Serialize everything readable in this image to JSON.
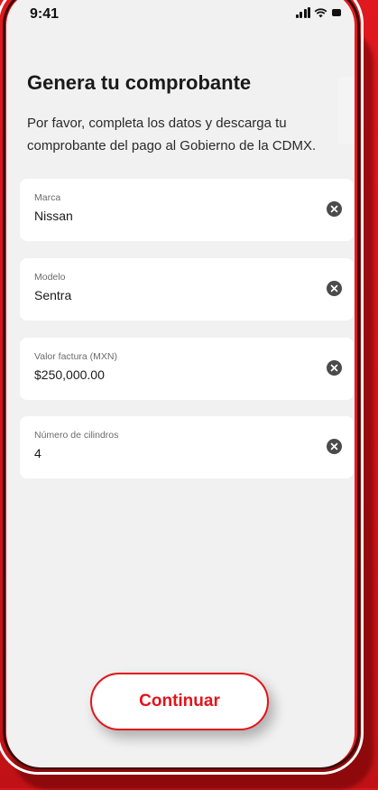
{
  "status_bar": {
    "time": "9:41"
  },
  "header": {
    "title": "Genera tu comprobante",
    "subtitle": "Por favor, completa los datos y descarga tu comprobante del pago al Gobierno de la CDMX."
  },
  "form": {
    "fields": [
      {
        "label": "Marca",
        "value": "Nissan",
        "clear_icon": "clear-icon"
      },
      {
        "label": "Modelo",
        "value": "Sentra",
        "clear_icon": "clear-icon"
      },
      {
        "label": "Valor factura (MXN)",
        "value": "$250,000.00",
        "clear_icon": "clear-icon"
      },
      {
        "label": "Número de cilindros",
        "value": "4",
        "clear_icon": "clear-icon"
      }
    ]
  },
  "actions": {
    "continue_label": "Continuar"
  },
  "colors": {
    "brand_red": "#e2141b",
    "screen_bg": "#f1f1f1",
    "card_bg": "#ffffff",
    "clear_icon": "#4b4b4b"
  }
}
